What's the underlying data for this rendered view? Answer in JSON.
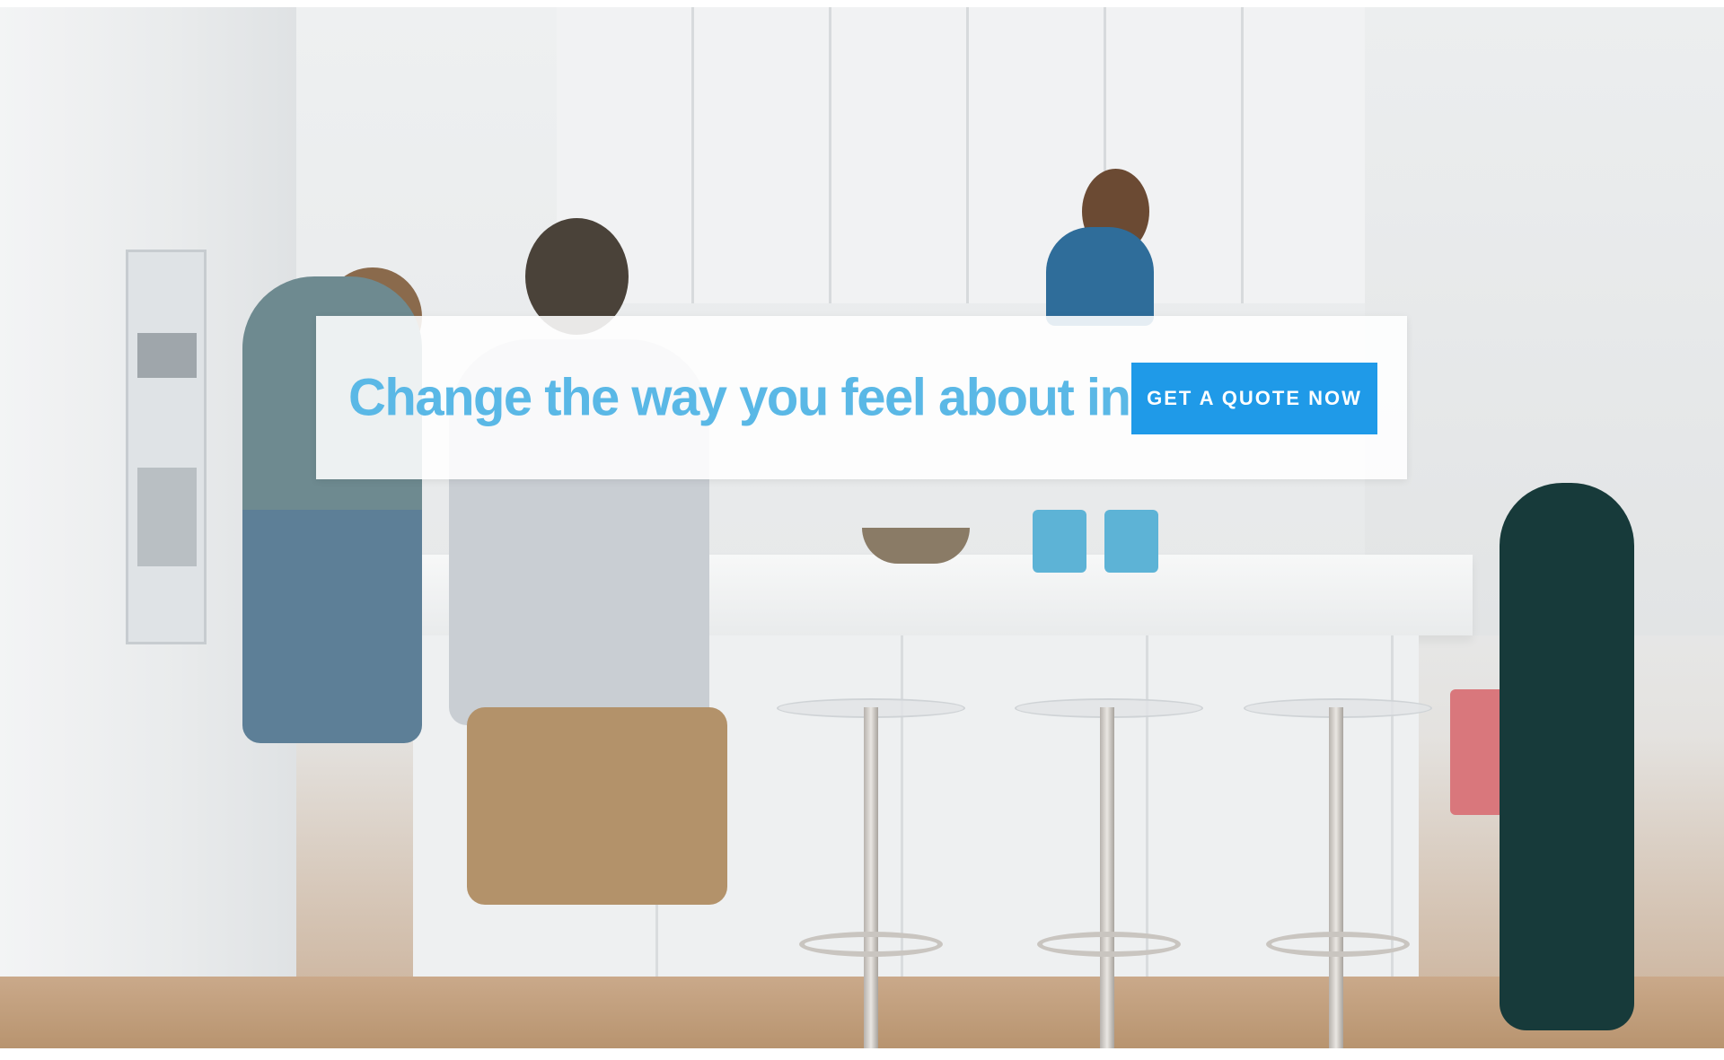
{
  "hero": {
    "image_icon": "family-kitchen-photo"
  },
  "banner": {
    "headline": "Change the way you feel about insurance.",
    "cta_label": "GET A QUOTE NOW"
  },
  "colors": {
    "headline": "#5ab8e6",
    "cta_background": "#1f9ae8",
    "cta_text": "#ffffff"
  }
}
